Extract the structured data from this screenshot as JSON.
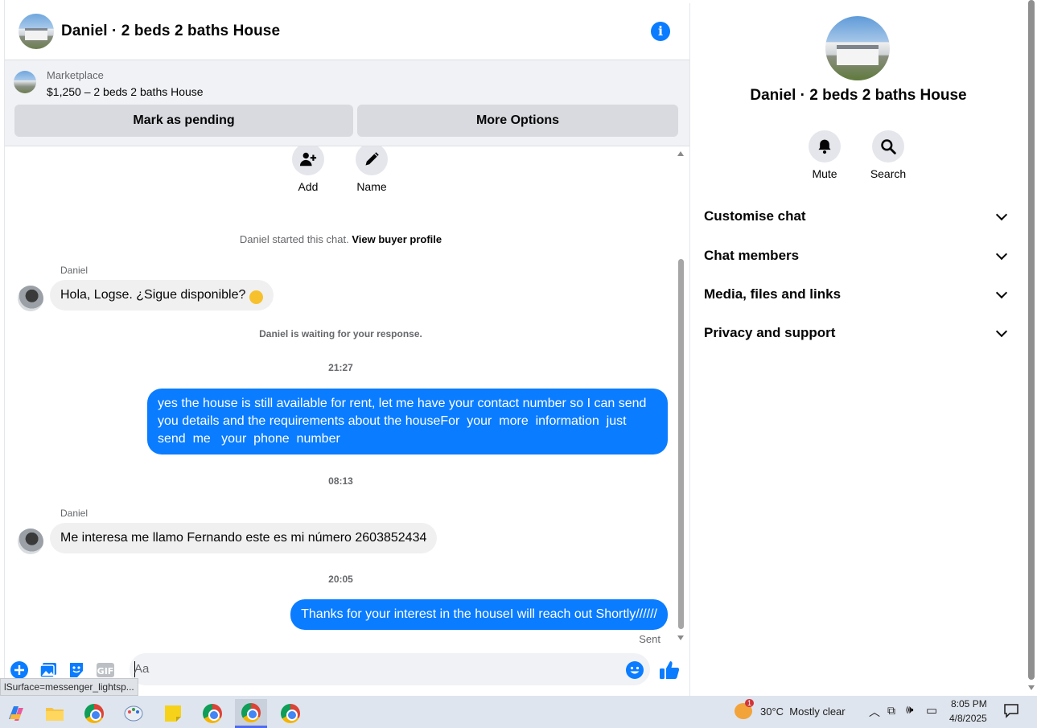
{
  "chat": {
    "title": "Daniel · 2 beds 2 baths House",
    "marketplace": {
      "label": "Marketplace",
      "item": "$1,250 – 2 beds 2 baths House",
      "mark_pending": "Mark as pending",
      "more_options": "More Options"
    },
    "actions": {
      "add": "Add",
      "name": "Name"
    },
    "started_text": "Daniel started this chat.",
    "view_profile": "View buyer profile",
    "waiting": "Daniel is waiting for your response.",
    "messages": [
      {
        "sender": "Daniel",
        "text": "Hola, Logse. ¿Sigue disponible?"
      },
      {
        "time": "21:27"
      },
      {
        "text": "yes the house is still available for rent, let me have your contact number so I can send you details and the requirements about the houseFor  your  more  information  just send  me   your  phone  number"
      },
      {
        "time": "08:13"
      },
      {
        "sender": "Daniel",
        "text": "Me interesa me llamo Fernando este es mi número 2603852434"
      },
      {
        "time": "20:05"
      },
      {
        "text": "Thanks for your interest in the houseI will reach out Shortly//////"
      }
    ],
    "sent_status": "Sent",
    "composer": {
      "placeholder": "Aa"
    },
    "status_url": "lSurface=messenger_lightsp..."
  },
  "details": {
    "title": "Daniel · 2 beds 2 baths House",
    "mute": "Mute",
    "search": "Search",
    "sections": [
      "Customise chat",
      "Chat members",
      "Media, files and links",
      "Privacy and support"
    ]
  },
  "taskbar": {
    "weather": "30°C  Mostly clear",
    "weather_badge": "1",
    "time": "8:05 PM",
    "date": "4/8/2025"
  },
  "colors": {
    "accent": "#0a7cff",
    "bubble_in": "#f0f0f0",
    "button_gray": "#d8dadf"
  }
}
